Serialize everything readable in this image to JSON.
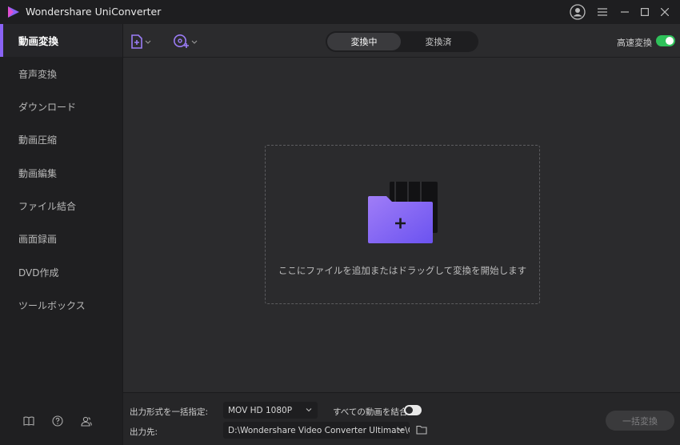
{
  "app": {
    "title": "Wondershare UniConverter"
  },
  "sidebar": {
    "items": [
      {
        "label": "動画変換",
        "active": true
      },
      {
        "label": "音声変換"
      },
      {
        "label": "ダウンロード"
      },
      {
        "label": "動画圧縮"
      },
      {
        "label": "動画編集"
      },
      {
        "label": "ファイル結合"
      },
      {
        "label": "画面録画"
      },
      {
        "label": "DVD作成"
      },
      {
        "label": "ツールボックス"
      }
    ],
    "bottom_icons": [
      "book-icon",
      "help-icon",
      "users-icon"
    ]
  },
  "toolbar": {
    "tabs": [
      {
        "label": "変換中",
        "active": true
      },
      {
        "label": "変換済"
      }
    ],
    "fast_convert_label": "高速変換",
    "fast_convert_on": true
  },
  "dropzone": {
    "text": "ここにファイルを追加またはドラッグして変換を開始します"
  },
  "bottom": {
    "output_format_label": "出力形式を一括指定:",
    "output_format_value": "MOV HD 1080P",
    "merge_label": "すべての動画を結合",
    "merge_on": false,
    "output_path_label": "出力先:",
    "output_path_value": "D:\\Wondershare Video Converter Ultimate\\Co",
    "convert_all_label": "一括変換"
  },
  "colors": {
    "accent": "#8a63f5",
    "toggle_on": "#2fc15a",
    "background": "#2b2b2d",
    "sidebar": "#1f1f21"
  }
}
